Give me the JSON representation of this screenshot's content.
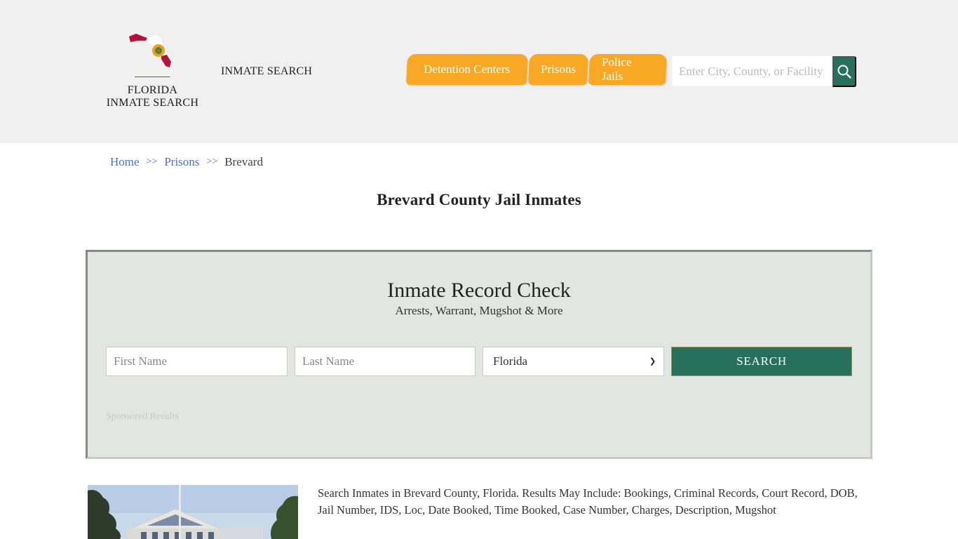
{
  "header": {
    "logo_line1": "FLORIDA",
    "logo_line2": "INMATE SEARCH",
    "site_link": "INMATE SEARCH",
    "nav": [
      {
        "label": "Detention Centers"
      },
      {
        "label": "Prisons"
      },
      {
        "label": "Police Jails"
      }
    ],
    "search_placeholder": "Enter City, County, or Facility",
    "search_icon": "search-icon"
  },
  "breadcrumb": {
    "items": [
      "Home",
      "Prisons"
    ],
    "separator": ">>",
    "current": "Brevard"
  },
  "page_title": "Brevard County Jail Inmates",
  "record_check": {
    "title": "Inmate Record Check",
    "subtitle": "Arrests, Warrant, Mugshot & More",
    "first_name_placeholder": "First Name",
    "last_name_placeholder": "Last Name",
    "state_selected": "Florida",
    "submit_label": "SEARCH",
    "sponsored": "Sponsored Results"
  },
  "description": "Search Inmates in Brevard County, Florida. Results May Include: Bookings, Criminal Records, Court Record, DOB, Jail Number, IDS, Loc, Date Booked, Time Booked, Case Number, Charges, Description, Mugshot",
  "colors": {
    "nav_accent": "#f8a824",
    "brand_green": "#27705b",
    "link_blue": "#4a6fd0",
    "panel_bg": "#e2e6e3"
  }
}
